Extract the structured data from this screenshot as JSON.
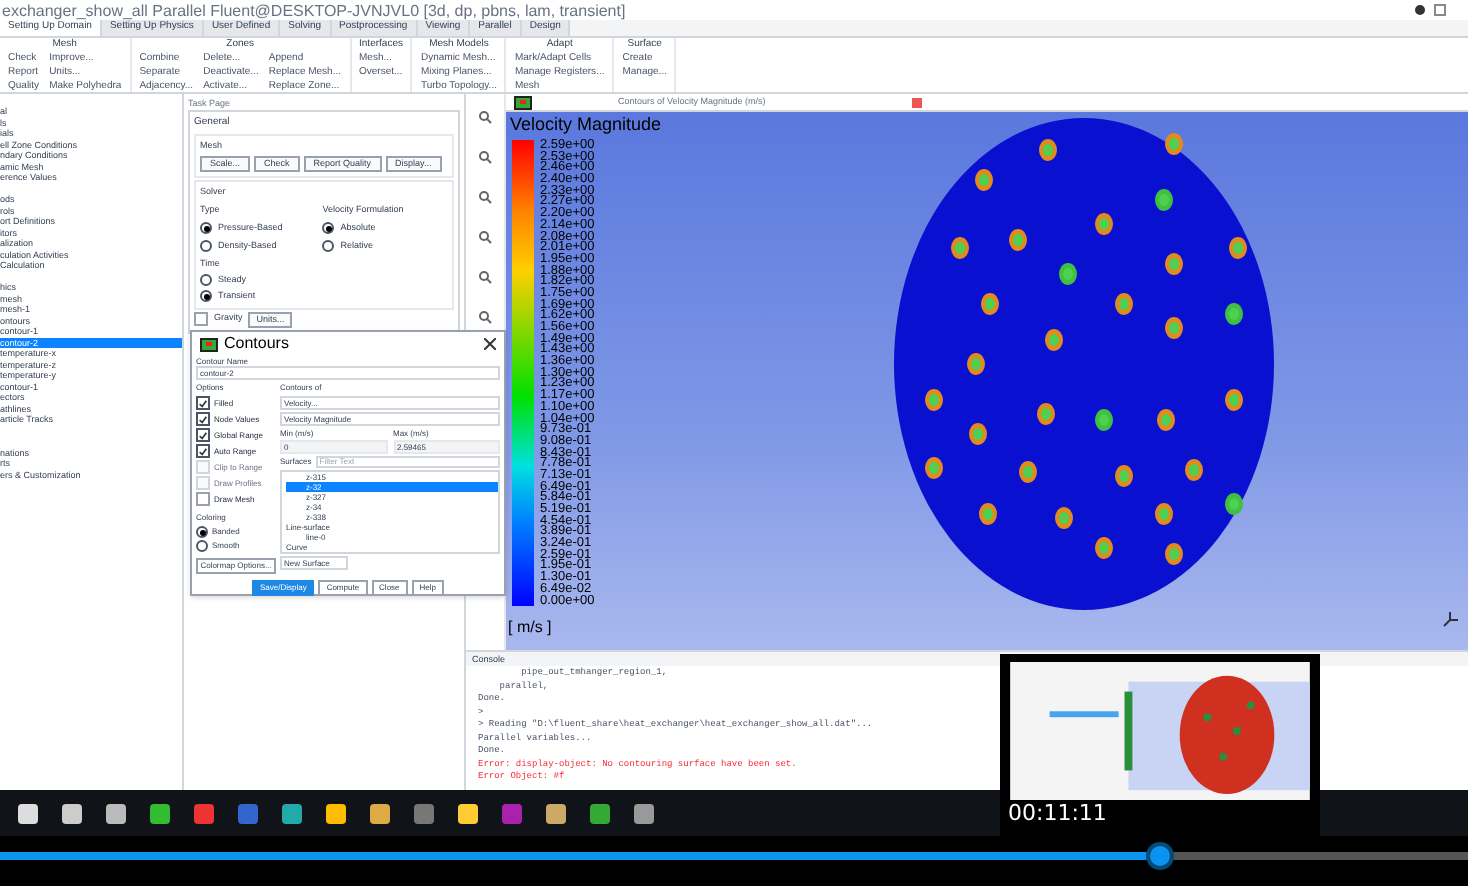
{
  "window": {
    "title": "exchanger_show_all Parallel Fluent@DESKTOP-JVNJVL0  [3d, dp, pbns, lam, transient]"
  },
  "tabs": [
    {
      "label": "Setting Up Domain",
      "selected": true
    },
    {
      "label": "Setting Up Physics",
      "selected": false
    },
    {
      "label": "User Defined",
      "selected": false
    },
    {
      "label": "Solving",
      "selected": false
    },
    {
      "label": "Postprocessing",
      "selected": false
    },
    {
      "label": "Viewing",
      "selected": false
    },
    {
      "label": "Parallel",
      "selected": false
    },
    {
      "label": "Design",
      "selected": false
    }
  ],
  "ribbon": [
    {
      "title": "Mesh",
      "items": [
        "Check",
        "Report",
        "Quality",
        "Improve...",
        "Units...",
        "Make Polyhedra"
      ]
    },
    {
      "title": "Zones",
      "items": [
        "Combine",
        "Separate",
        "Adjacency...",
        "Delete...",
        "Deactivate...",
        "Activate...",
        "Append",
        "Replace Mesh...",
        "Replace Zone..."
      ]
    },
    {
      "title": "Interfaces",
      "items": [
        "Mesh...",
        "Overset..."
      ]
    },
    {
      "title": "Mesh Models",
      "items": [
        "Dynamic Mesh...",
        "Mixing Planes...",
        "Turbo Topology..."
      ]
    },
    {
      "title": "Adapt",
      "items": [
        "Mark/Adapt Cells",
        "Manage Registers...",
        "Mesh"
      ]
    },
    {
      "title": "Surface",
      "items": [
        "Create",
        "Manage..."
      ]
    }
  ],
  "tree": [
    {
      "items": [
        {
          "label": "al",
          "selected": false
        },
        {
          "label": "ls",
          "selected": false
        },
        {
          "label": "ials",
          "selected": false
        },
        {
          "label": "ell Zone Conditions",
          "selected": false
        },
        {
          "label": "ndary Conditions",
          "selected": false
        },
        {
          "label": "amic Mesh",
          "selected": false
        },
        {
          "label": "erence Values",
          "selected": false
        }
      ]
    },
    {
      "items": [
        {
          "label": "ods",
          "selected": false
        },
        {
          "label": "rols",
          "selected": false
        },
        {
          "label": "ort Definitions",
          "selected": false
        },
        {
          "label": "itors",
          "selected": false
        },
        {
          "label": "alization",
          "selected": false
        },
        {
          "label": "culation Activities",
          "selected": false
        },
        {
          "label": "Calculation",
          "selected": false
        }
      ]
    },
    {
      "items": [
        {
          "label": "hics",
          "selected": false
        },
        {
          "label": "mesh",
          "selected": false
        },
        {
          "label": "mesh-1",
          "selected": false
        },
        {
          "label": "ontours",
          "selected": false
        },
        {
          "label": "contour-1",
          "selected": false
        },
        {
          "label": "contour-2",
          "selected": true
        },
        {
          "label": "temperature-x",
          "selected": false
        },
        {
          "label": "temperature-z",
          "selected": false
        },
        {
          "label": "temperature-y",
          "selected": false
        },
        {
          "label": "contour-1",
          "selected": false
        },
        {
          "label": "ectors",
          "selected": false
        },
        {
          "label": "athlines",
          "selected": false
        },
        {
          "label": "article Tracks",
          "selected": false
        }
      ]
    },
    {
      "items": [
        {
          "label": "nations",
          "selected": false
        },
        {
          "label": "rts",
          "selected": false
        },
        {
          "label": "ers & Customization",
          "selected": false
        }
      ]
    }
  ],
  "task_page": {
    "title": "Task Page",
    "heading": "General",
    "mesh_label": "Mesh",
    "mesh_buttons": [
      "Scale...",
      "Check",
      "Report Quality",
      "Display..."
    ],
    "solver_label": "Solver",
    "type_label": "Type",
    "types": [
      {
        "label": "Pressure-Based",
        "selected": true
      },
      {
        "label": "Density-Based",
        "selected": false
      }
    ],
    "velocity_label": "Velocity Formulation",
    "velocity": [
      {
        "label": "Absolute",
        "selected": true
      },
      {
        "label": "Relative",
        "selected": false
      }
    ],
    "time_label": "Time",
    "time": [
      {
        "label": "Steady",
        "selected": false
      },
      {
        "label": "Transient",
        "selected": true
      }
    ],
    "gravity": {
      "label": "Gravity",
      "checked": false
    },
    "units_button": "Units..."
  },
  "graphics": {
    "tab_title": "Contours of Velocity Magnitude (m/s)",
    "legend_title": "Velocity Magnitude",
    "legend_labels": [
      "2.59e+00",
      "2.53e+00",
      "2.46e+00",
      "2.40e+00",
      "2.33e+00",
      "2.27e+00",
      "2.20e+00",
      "2.14e+00",
      "2.08e+00",
      "2.01e+00",
      "1.95e+00",
      "1.88e+00",
      "1.82e+00",
      "1.75e+00",
      "1.69e+00",
      "1.62e+00",
      "1.56e+00",
      "1.49e+00",
      "1.43e+00",
      "1.36e+00",
      "1.30e+00",
      "1.23e+00",
      "1.17e+00",
      "1.10e+00",
      "1.04e+00",
      "9.73e-01",
      "9.08e-01",
      "8.43e-01",
      "7.78e-01",
      "7.13e-01",
      "6.49e-01",
      "5.84e-01",
      "5.19e-01",
      "4.54e-01",
      "3.89e-01",
      "3.24e-01",
      "2.59e-01",
      "1.95e-01",
      "1.30e-01",
      "6.49e-02",
      "0.00e+00"
    ],
    "units": "[ m/s ]"
  },
  "dialog": {
    "title": "Contours",
    "name_label": "Contour Name",
    "name": "contour-2",
    "options_label": "Options",
    "options": [
      {
        "label": "Filled",
        "checked": true,
        "disabled": false
      },
      {
        "label": "Node Values",
        "checked": true,
        "disabled": false
      },
      {
        "label": "Global Range",
        "checked": true,
        "disabled": false
      },
      {
        "label": "Auto Range",
        "checked": true,
        "disabled": false
      },
      {
        "label": "Clip to Range",
        "checked": false,
        "disabled": true
      },
      {
        "label": "Draw Profiles",
        "checked": false,
        "disabled": true
      },
      {
        "label": "Draw Mesh",
        "checked": false,
        "disabled": false
      }
    ],
    "coloring_label": "Coloring",
    "coloring": [
      {
        "label": "Banded",
        "selected": true
      },
      {
        "label": "Smooth",
        "selected": false
      }
    ],
    "colormap_button": "Colormap Options...",
    "contours_of_label": "Contours of",
    "field": "Velocity...",
    "subfield": "Velocity Magnitude",
    "min_label": "Min (m/s)",
    "min": "0",
    "max_label": "Max (m/s)",
    "max": "2.59465",
    "surfaces_label": "Surfaces",
    "filter_placeholder": "Filter Text",
    "surfaces": [
      {
        "label": "z-315",
        "kind": "item",
        "selected": false
      },
      {
        "label": "z-32",
        "kind": "item",
        "selected": true
      },
      {
        "label": "z-327",
        "kind": "item",
        "selected": false
      },
      {
        "label": "z-34",
        "kind": "item",
        "selected": false
      },
      {
        "label": "z-338",
        "kind": "item",
        "selected": false
      },
      {
        "label": "Line-surface",
        "kind": "group",
        "selected": false
      },
      {
        "label": "line-0",
        "kind": "item",
        "selected": false
      },
      {
        "label": "Curve",
        "kind": "group",
        "selected": false
      }
    ],
    "new_surface": "New Surface",
    "buttons": [
      {
        "label": "Save/Display",
        "primary": true
      },
      {
        "label": "Compute",
        "primary": false
      },
      {
        "label": "Close",
        "primary": false
      },
      {
        "label": "Help",
        "primary": false
      }
    ]
  },
  "console": {
    "title": "Console",
    "lines": [
      {
        "text": "        pipe_out_tmhanger_region_1,",
        "kind": "normal"
      },
      {
        "text": "    parallel,",
        "kind": "normal"
      },
      {
        "text": "Done.",
        "kind": "normal"
      },
      {
        "text": ">",
        "kind": "normal"
      },
      {
        "text": "> Reading \"D:\\fluent_share\\heat_exchanger\\heat_exchanger_show_all.dat\"...",
        "kind": "normal"
      },
      {
        "text": "Parallel variables...",
        "kind": "normal"
      },
      {
        "text": "Done.",
        "kind": "normal"
      },
      {
        "text": "Error: display-object: No contouring surface have been set.",
        "kind": "error"
      },
      {
        "text": "Error Object: #f",
        "kind": "error"
      }
    ]
  },
  "player": {
    "time": "00:11:11",
    "level": 0.79
  }
}
